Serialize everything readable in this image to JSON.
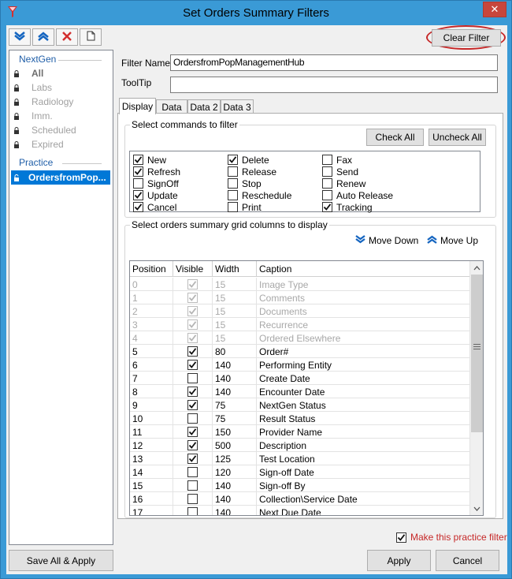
{
  "window": {
    "title": "Set Orders Summary Filters",
    "close_glyph": "✕"
  },
  "toolbar": {
    "icons": [
      "move-down-icon",
      "move-up-icon",
      "delete-icon",
      "new-document-icon"
    ]
  },
  "tree": {
    "groups": [
      {
        "label": "NextGen",
        "items": [
          "All",
          "Labs",
          "Radiology",
          "Imm.",
          "Scheduled",
          "Expired"
        ]
      },
      {
        "label": "Practice",
        "items": [
          "OrdersfromPop..."
        ]
      }
    ]
  },
  "buttons": {
    "clear_filter": "Clear Filter",
    "save_all": "Save All & Apply",
    "apply": "Apply",
    "cancel": "Cancel",
    "check_all": "Check All",
    "uncheck_all": "Uncheck All",
    "move_down": "Move Down",
    "move_up": "Move Up"
  },
  "fields": {
    "filter_name_label": "Filter Name",
    "filter_name_value": "OrdersfromPopManagementHub",
    "tooltip_label": "ToolTip",
    "tooltip_value": ""
  },
  "tabs": [
    "Display",
    "Data",
    "Data 2",
    "Data 3"
  ],
  "commands_group": {
    "title": "Select commands to filter",
    "items": [
      {
        "label": "New",
        "checked": true
      },
      {
        "label": "Refresh",
        "checked": true
      },
      {
        "label": "SignOff",
        "checked": false
      },
      {
        "label": "Update",
        "checked": true
      },
      {
        "label": "Cancel",
        "checked": true
      },
      {
        "label": "Delete",
        "checked": true
      },
      {
        "label": "Release",
        "checked": false
      },
      {
        "label": "Stop",
        "checked": false
      },
      {
        "label": "Reschedule",
        "checked": false
      },
      {
        "label": "Print",
        "checked": false
      },
      {
        "label": "Fax",
        "checked": false
      },
      {
        "label": "Send",
        "checked": false
      },
      {
        "label": "Renew",
        "checked": false
      },
      {
        "label": "Auto Release",
        "checked": false
      },
      {
        "label": "Tracking",
        "checked": true
      }
    ]
  },
  "columns_group": {
    "title": "Select orders summary grid columns to display",
    "headers": [
      "Position",
      "Visible",
      "Width",
      "Caption"
    ],
    "rows": [
      {
        "position": "0",
        "visible": true,
        "width": "15",
        "caption": "Image Type",
        "disabled": true
      },
      {
        "position": "1",
        "visible": true,
        "width": "15",
        "caption": "Comments",
        "disabled": true
      },
      {
        "position": "2",
        "visible": true,
        "width": "15",
        "caption": "Documents",
        "disabled": true
      },
      {
        "position": "3",
        "visible": true,
        "width": "15",
        "caption": "Recurrence",
        "disabled": true
      },
      {
        "position": "4",
        "visible": true,
        "width": "15",
        "caption": "Ordered Elsewhere",
        "disabled": true
      },
      {
        "position": "5",
        "visible": true,
        "width": "80",
        "caption": "Order#",
        "disabled": false
      },
      {
        "position": "6",
        "visible": true,
        "width": "140",
        "caption": "Performing Entity",
        "disabled": false
      },
      {
        "position": "7",
        "visible": false,
        "width": "140",
        "caption": "Create Date",
        "disabled": false
      },
      {
        "position": "8",
        "visible": true,
        "width": "140",
        "caption": "Encounter Date",
        "disabled": false
      },
      {
        "position": "9",
        "visible": true,
        "width": "75",
        "caption": "NextGen Status",
        "disabled": false
      },
      {
        "position": "10",
        "visible": false,
        "width": "75",
        "caption": "Result Status",
        "disabled": false
      },
      {
        "position": "11",
        "visible": true,
        "width": "150",
        "caption": "Provider Name",
        "disabled": false
      },
      {
        "position": "12",
        "visible": true,
        "width": "500",
        "caption": "Description",
        "disabled": false
      },
      {
        "position": "13",
        "visible": true,
        "width": "125",
        "caption": "Test Location",
        "disabled": false
      },
      {
        "position": "14",
        "visible": false,
        "width": "120",
        "caption": "Sign-off Date",
        "disabled": false
      },
      {
        "position": "15",
        "visible": false,
        "width": "140",
        "caption": "Sign-off By",
        "disabled": false
      },
      {
        "position": "16",
        "visible": false,
        "width": "140",
        "caption": "Collection\\Service Date",
        "disabled": false
      },
      {
        "position": "17",
        "visible": false,
        "width": "140",
        "caption": "Next Due Date",
        "disabled": false
      }
    ]
  },
  "practice_filter": {
    "label": "Make this practice filter",
    "checked": true
  },
  "colors": {
    "accent": "#0078d7",
    "title_bar": "#3a9ad6",
    "warning": "#c62828"
  }
}
